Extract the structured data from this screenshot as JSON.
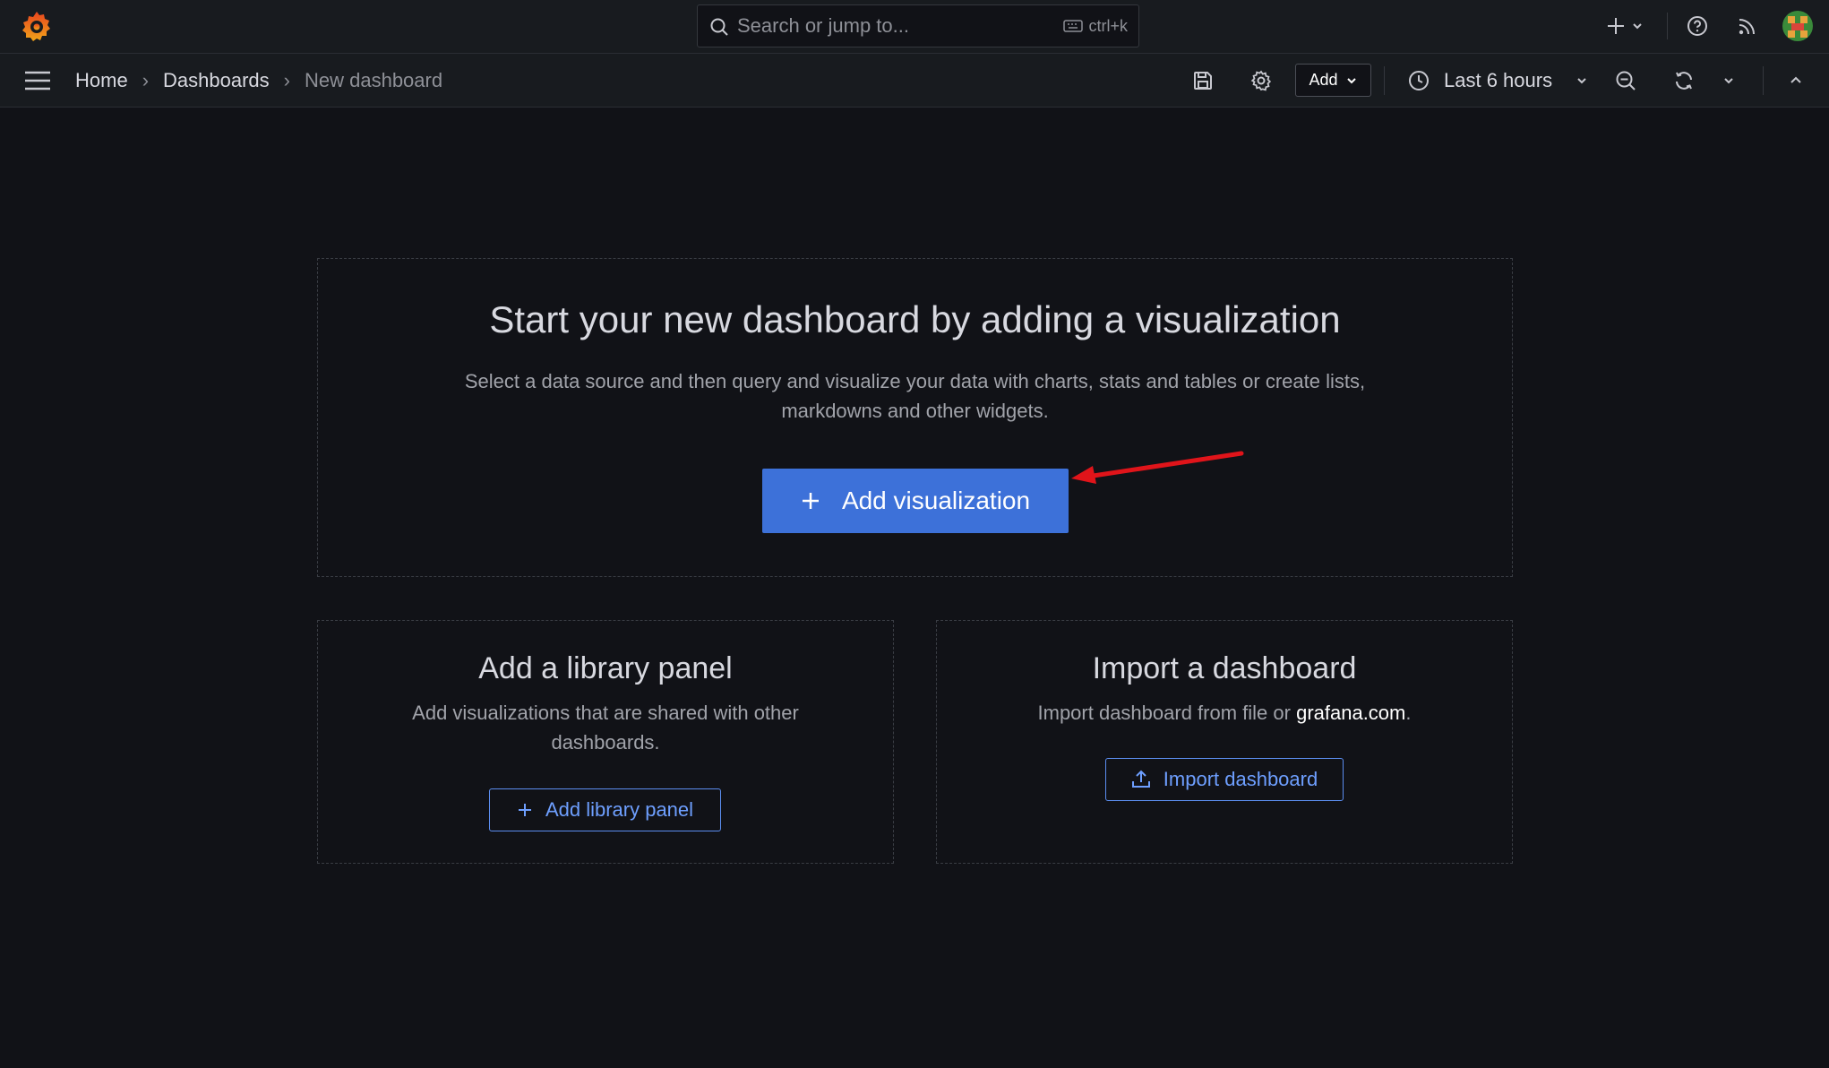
{
  "search": {
    "placeholder": "Search or jump to...",
    "shortcut": "ctrl+k"
  },
  "breadcrumb": {
    "home": "Home",
    "dashboards": "Dashboards",
    "current": "New dashboard"
  },
  "toolbar": {
    "add_label": "Add",
    "time_range": "Last 6 hours"
  },
  "main": {
    "title": "Start your new dashboard by adding a visualization",
    "description": "Select a data source and then query and visualize your data with charts, stats and tables or create lists, markdowns and other widgets.",
    "button": "Add visualization"
  },
  "library": {
    "title": "Add a library panel",
    "description": "Add visualizations that are shared with other dashboards.",
    "button": "Add library panel"
  },
  "import": {
    "title": "Import a dashboard",
    "description_pre": "Import dashboard from file or ",
    "link": "grafana.com",
    "description_post": ".",
    "button": "Import dashboard"
  },
  "colors": {
    "accent": "#3d71d9",
    "annotation_arrow": "#e0141a",
    "background": "#111217"
  }
}
